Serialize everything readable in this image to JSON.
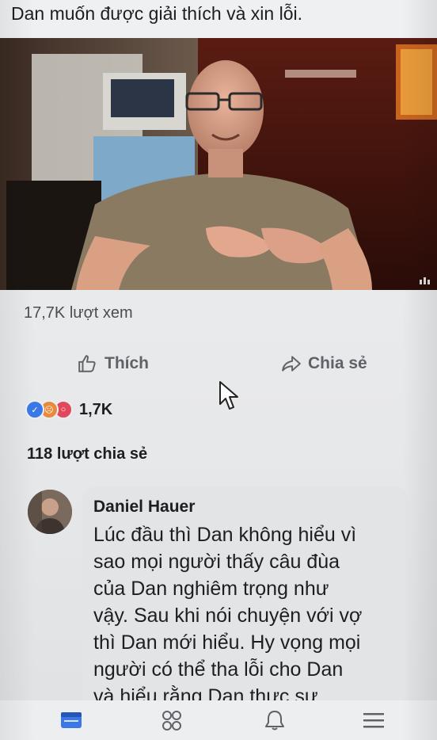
{
  "post": {
    "text": "Dan muốn được giải thích và xin lỗi."
  },
  "video": {
    "stats": {
      "views": "17,7K lượt xem"
    }
  },
  "actions": {
    "like_label": "Thích",
    "like_icon": "thumbs-up-icon",
    "share_label": "Chia sẻ",
    "share_icon": "share-arrow-icon"
  },
  "reactions": {
    "icons": [
      "like-icon",
      "angry-icon",
      "sad-icon"
    ],
    "count": "1,7K"
  },
  "shares": {
    "text": "118 lượt chia sẻ"
  },
  "comment": {
    "author": "Daniel Hauer",
    "lines": [
      "Lúc đầu thì Dan không hiểu vì",
      "sao mọi người thấy câu đùa",
      "của Dan nghiêm trọng như",
      "vậy. Sau khi nói chuyện với vợ",
      "thì Dan mới hiểu. Hy vọng mọi",
      "người có thể tha lỗi cho Dan",
      "và hiểu rằng Dan thực sự"
    ]
  },
  "tabbar": {
    "tabs": [
      {
        "icon": "news-feed-icon",
        "active": true
      },
      {
        "icon": "friends-icon",
        "active": false
      },
      {
        "icon": "bell-icon",
        "active": false
      },
      {
        "icon": "menu-icon",
        "active": false
      }
    ]
  },
  "colors": {
    "accent": "#3b78e7",
    "text": "#1c1e21",
    "muted": "#5f6368",
    "background": "#eceeef"
  }
}
